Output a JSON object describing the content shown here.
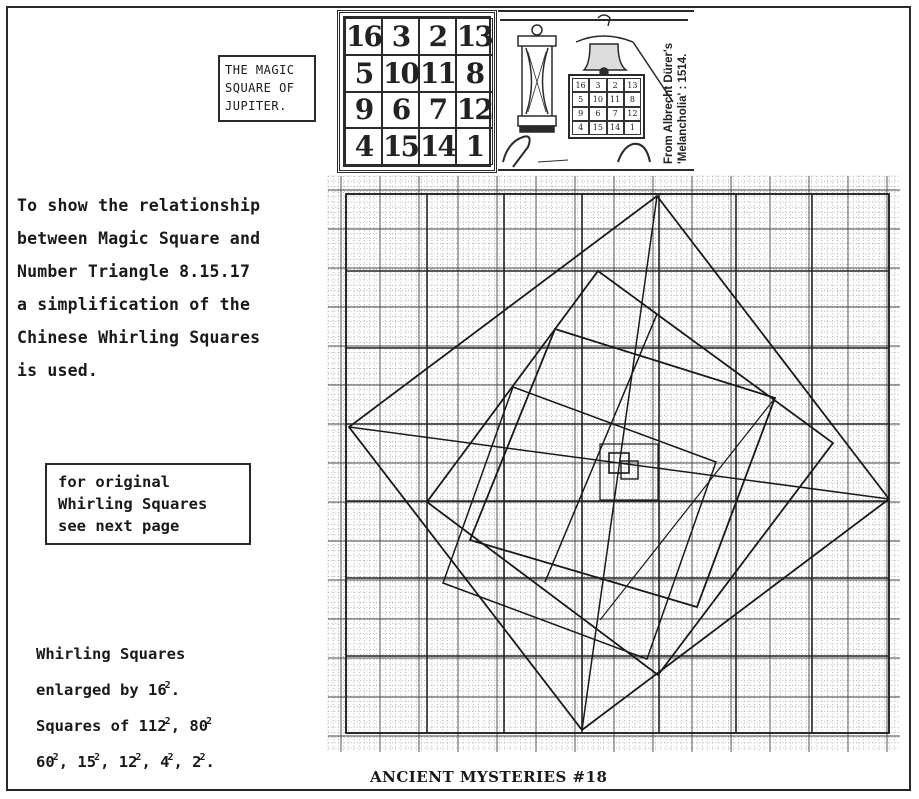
{
  "page": {
    "footer_title": "ANCIENT MYSTERIES #18"
  },
  "title_box": {
    "lines": [
      "THE MAGIC",
      "SQUARE OF",
      "JUPITER."
    ]
  },
  "magic_square": {
    "rows": [
      [
        16,
        3,
        2,
        13
      ],
      [
        5,
        10,
        11,
        8
      ],
      [
        9,
        6,
        7,
        12
      ],
      [
        4,
        15,
        14,
        1
      ]
    ]
  },
  "durer_panel": {
    "caption_line1": "From Albrecht Dürer's",
    "caption_line2": "'Melancholia' : 1514.",
    "illustration": "engraving-detail-hourglass-bell-magic-square",
    "mini_square_rows": [
      [
        16,
        3,
        2,
        13
      ],
      [
        5,
        10,
        11,
        8
      ],
      [
        9,
        6,
        7,
        12
      ],
      [
        4,
        15,
        14,
        1
      ]
    ]
  },
  "intro_text": {
    "lines": [
      "To show the relationship",
      "between Magic Square and",
      "Number Triangle 8.15.17",
      "a simplification of the",
      "Chinese Whirling Squares",
      "is used."
    ]
  },
  "note_box": {
    "lines": [
      "for original",
      "Whirling Squares",
      "see next page"
    ]
  },
  "squares_text": {
    "line1": "Whirling Squares",
    "line2_prefix": "enlarged by 16",
    "line2_suffix": ".",
    "line3_prefix": "Squares of ",
    "line3_items": [
      "112",
      "80"
    ],
    "line4_items": [
      "60",
      "15",
      "12",
      "4",
      "2"
    ],
    "exponent": "2"
  },
  "diagram": {
    "description": "Whirling squares drawn on graph paper",
    "square_sides": [
      112,
      80,
      60,
      15,
      12,
      4,
      2
    ],
    "number_triangle": [
      8,
      15,
      17
    ],
    "enlargement_factor": 16
  }
}
